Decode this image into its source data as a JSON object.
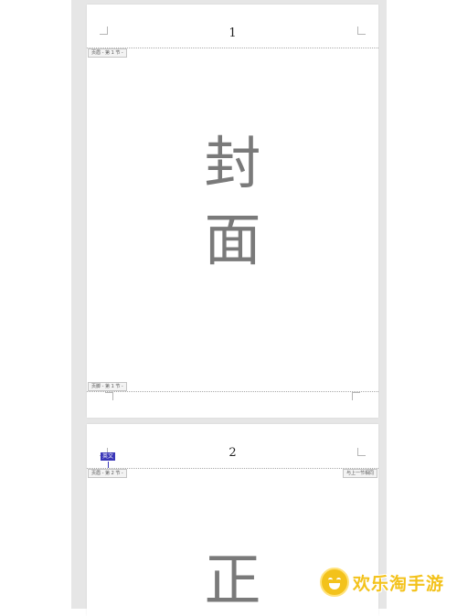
{
  "page1": {
    "number": "1",
    "header_tag": "页眉 - 第 1 节 -",
    "footer_tag": "页脚 - 第 1 节 -",
    "title_chars": [
      "封",
      "面"
    ]
  },
  "page2": {
    "number": "2",
    "header_tag": "页眉 - 第 2 节 -",
    "link_tag": "与上一节相同",
    "ime_badge": "英文",
    "body_char": "正"
  },
  "watermark": {
    "text": "欢乐淘手游",
    "logo": "smiley-logo"
  },
  "colors": {
    "canvas": "#e6e6e6",
    "page": "#ffffff",
    "title_text": "#7a7a7a",
    "badge": "#3a36b8",
    "watermark": "#f3c21b"
  }
}
